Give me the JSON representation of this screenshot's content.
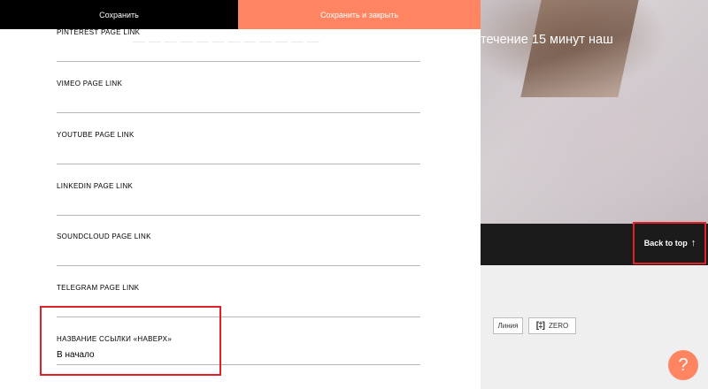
{
  "topbar": {
    "save_label": "Сохранить",
    "save_close_label": "Сохранить и закрыть"
  },
  "preview": {
    "hero_text": "течение 15 минут наш",
    "back_to_top_label": "Back to top",
    "back_to_top_arrow": "↑",
    "type_buttons": {
      "line_label": "Линия",
      "zero_label": "ZERO",
      "zero_icon": "[‡]"
    },
    "help_label": "?"
  },
  "panel": {
    "fields": [
      {
        "label": "PINTEREST PAGE LINK",
        "value": ""
      },
      {
        "label": "VIMEO PAGE LINK",
        "value": ""
      },
      {
        "label": "YOUTUBE PAGE LINK",
        "value": ""
      },
      {
        "label": "LINKEDIN PAGE LINK",
        "value": ""
      },
      {
        "label": "SOUNDCLOUD PAGE LINK",
        "value": ""
      },
      {
        "label": "TELEGRAM PAGE LINK",
        "value": ""
      },
      {
        "label": "НАЗВАНИЕ ССЫЛКИ «НАВЕРХ»",
        "value": "В начало"
      }
    ]
  },
  "colors": {
    "accent": "#ff8562",
    "highlight": "#e0212a",
    "dark_band": "#1b1b1b"
  }
}
